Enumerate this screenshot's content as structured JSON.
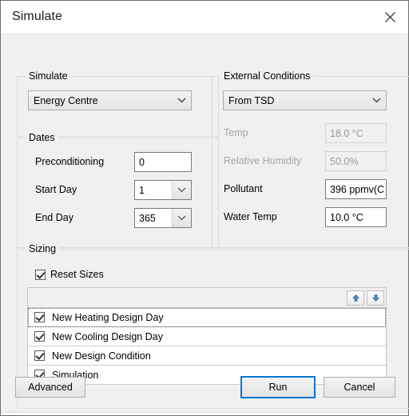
{
  "window": {
    "title": "Simulate",
    "close_icon": "close-icon"
  },
  "simulate_group": {
    "title": "Simulate",
    "target_combo": {
      "value": "Energy Centre",
      "chevron_icon": "chevron-down-icon"
    }
  },
  "dates_group": {
    "title": "Dates",
    "preconditioning": {
      "label": "Preconditioning",
      "value": "0"
    },
    "start_day": {
      "label": "Start Day",
      "value": "1",
      "chevron_icon": "chevron-down-icon"
    },
    "end_day": {
      "label": "End Day",
      "value": "365",
      "chevron_icon": "chevron-down-icon"
    }
  },
  "external_group": {
    "title": "External Conditions",
    "source_combo": {
      "value": "From TSD",
      "chevron_icon": "chevron-down-icon"
    },
    "temp": {
      "label": "Temp",
      "value": "18.0 °C",
      "enabled": false
    },
    "relative_humidity": {
      "label": "Relative Humidity",
      "value": "50.0%",
      "enabled": false
    },
    "pollutant": {
      "label": "Pollutant",
      "value": "396 ppmv(C",
      "enabled": true
    },
    "water_temp": {
      "label": "Water Temp",
      "value": "10.0 °C",
      "enabled": true
    }
  },
  "sizing_group": {
    "title": "Sizing",
    "reset_sizes": {
      "label": "Reset Sizes",
      "checked": true
    },
    "toolbar": {
      "move_up_icon": "arrow-up-icon",
      "move_down_icon": "arrow-down-icon"
    },
    "items": [
      {
        "label": "New Heating Design Day",
        "checked": true,
        "focused": true
      },
      {
        "label": "New Cooling Design Day",
        "checked": true,
        "focused": false
      },
      {
        "label": "New Design Condition",
        "checked": true,
        "focused": false
      },
      {
        "label": "Simulation",
        "checked": true,
        "focused": false
      }
    ]
  },
  "footer": {
    "advanced_label": "Advanced",
    "run_label": "Run",
    "cancel_label": "Cancel"
  },
  "colors": {
    "accent": "#0078d7",
    "dialog_bg": "#f0f0f0",
    "titlebar_bg": "#ffffff",
    "arrow_blue": "#4a86c8"
  }
}
